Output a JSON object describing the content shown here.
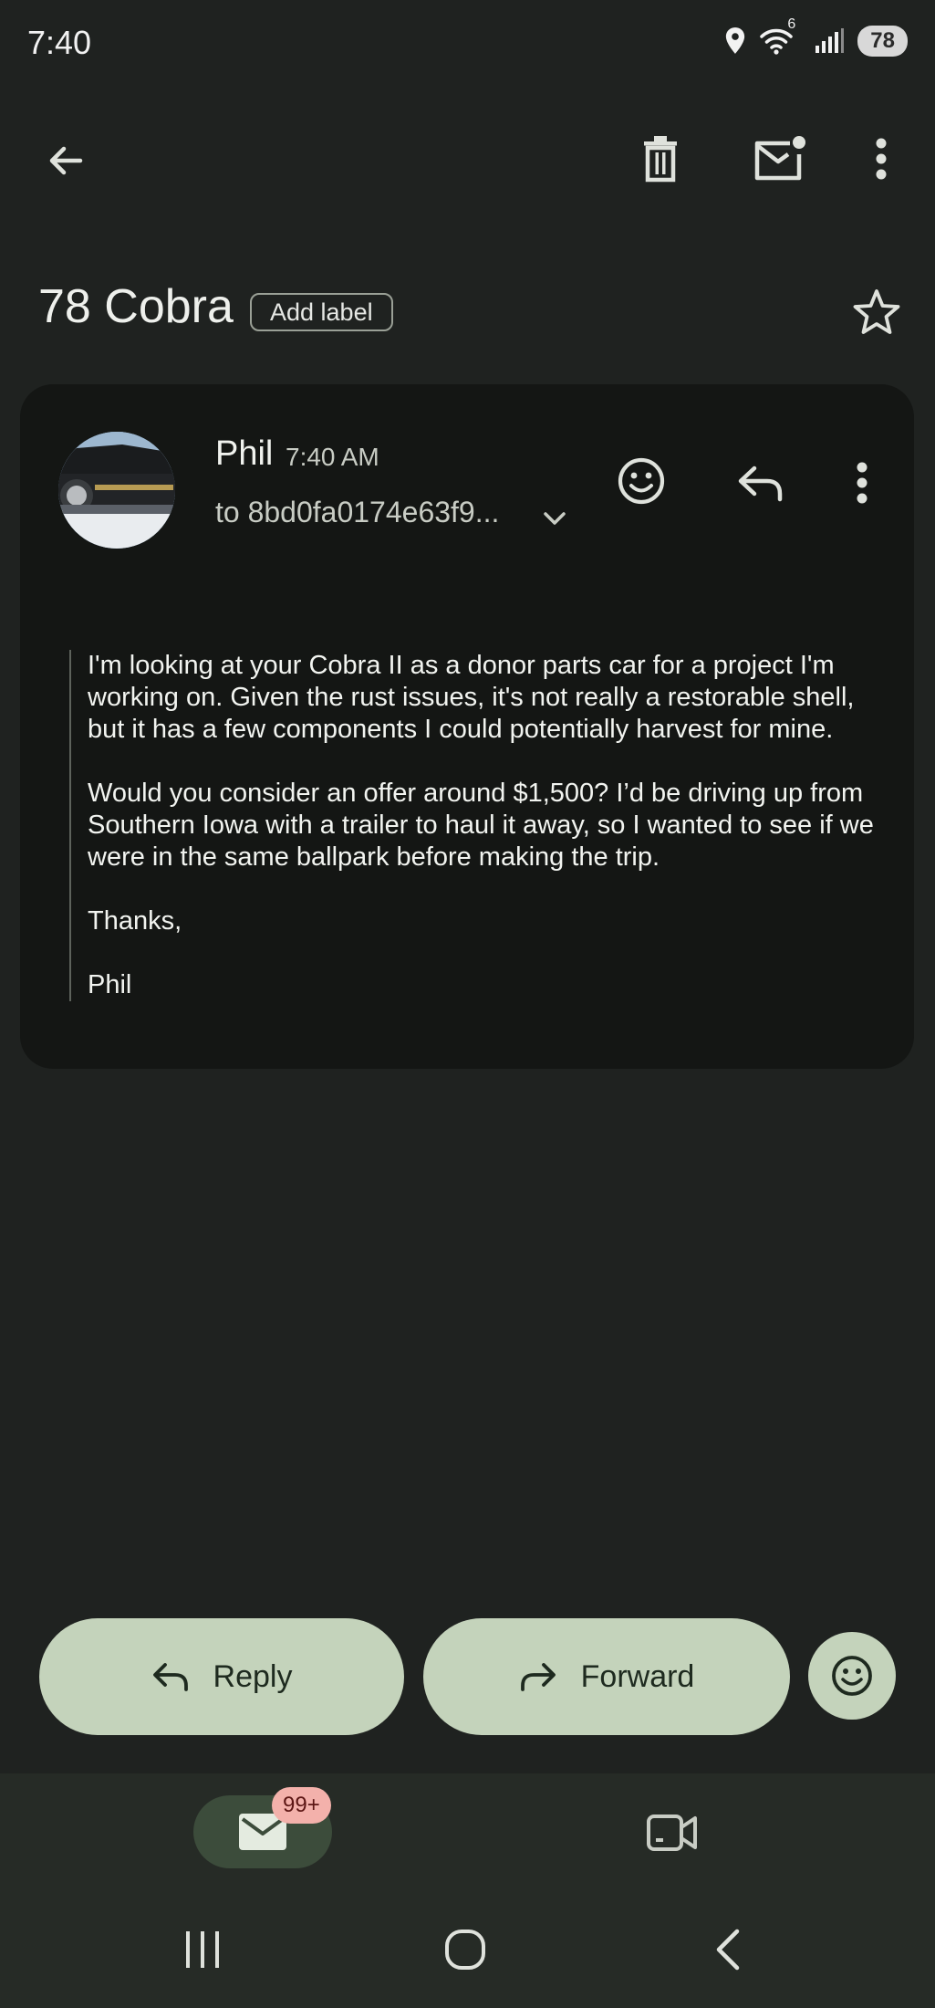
{
  "status_bar": {
    "time": "7:40",
    "wifi_generation": "6",
    "battery": "78"
  },
  "app_bar": {
    "icons": [
      "back-arrow-icon",
      "delete-icon",
      "mark-unread-icon",
      "more-vert-icon"
    ]
  },
  "subject": {
    "title": "78 Cobra",
    "add_label": "Add label"
  },
  "message": {
    "sender": "Phil",
    "time": "7:40 AM",
    "recipient": "to 8bd0fa0174e63f9...",
    "body": [
      "I'm looking at your Cobra II as a donor parts car for a project I'm working on. Given the rust issues, it's not really a restorable shell, but it has a few components I could potentially harvest for mine.",
      "Would you consider an offer around $1,500? I’d be driving up from Southern Iowa with a trailer to haul it away, so I wanted to see if we were in the same ballpark before making the trip.",
      "Thanks,",
      "Phil"
    ]
  },
  "actions": {
    "reply": "Reply",
    "forward": "Forward"
  },
  "bottom_nav": {
    "mail_badge": "99+"
  },
  "colors": {
    "background": "#1f2220",
    "card": "#141614",
    "pill": "#c4d3bb",
    "badge": "#f3b1ab"
  }
}
